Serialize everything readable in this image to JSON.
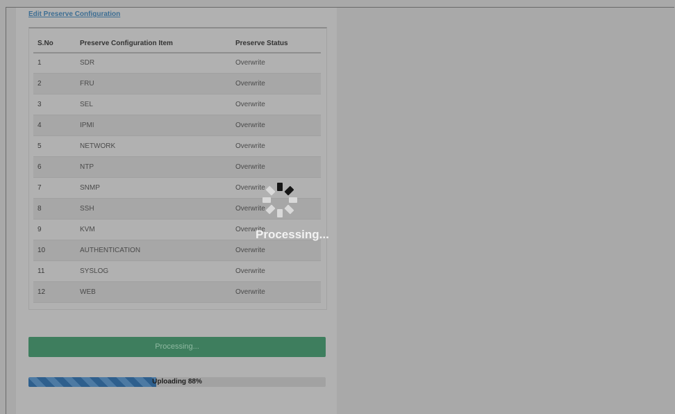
{
  "edit_link": "Edit Preserve Configuration",
  "table": {
    "headers": {
      "sno": "S.No",
      "item": "Preserve Configuration Item",
      "status": "Preserve Status"
    },
    "rows": [
      {
        "sno": "1",
        "item": "SDR",
        "status": "Overwrite"
      },
      {
        "sno": "2",
        "item": "FRU",
        "status": "Overwrite"
      },
      {
        "sno": "3",
        "item": "SEL",
        "status": "Overwrite"
      },
      {
        "sno": "4",
        "item": "IPMI",
        "status": "Overwrite"
      },
      {
        "sno": "5",
        "item": "NETWORK",
        "status": "Overwrite"
      },
      {
        "sno": "6",
        "item": "NTP",
        "status": "Overwrite"
      },
      {
        "sno": "7",
        "item": "SNMP",
        "status": "Overwrite"
      },
      {
        "sno": "8",
        "item": "SSH",
        "status": "Overwrite"
      },
      {
        "sno": "9",
        "item": "KVM",
        "status": "Overwrite"
      },
      {
        "sno": "10",
        "item": "AUTHENTICATION",
        "status": "Overwrite"
      },
      {
        "sno": "11",
        "item": "SYSLOG",
        "status": "Overwrite"
      },
      {
        "sno": "12",
        "item": "WEB",
        "status": "Overwrite"
      }
    ]
  },
  "action_button": "Processing...",
  "progress": {
    "label": "Uploading 88%",
    "value": 0.43
  },
  "overlay": {
    "title": "Processing...",
    "spinner_icon": "loading-spinner-icon"
  },
  "colors": {
    "button": "#3e7e5e",
    "progress_fill": "#2e5f8d",
    "link": "#3d6e93"
  }
}
